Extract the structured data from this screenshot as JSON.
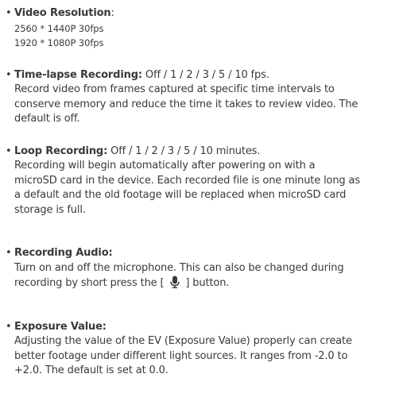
{
  "bullet": "•",
  "sections": [
    {
      "label": "Video Resolution",
      "label_suffix": ":",
      "sub_lines": [
        "2560 * 1440P 30fps",
        "1920 * 1080P 30fps"
      ]
    },
    {
      "label": "Time-lapse Recording:",
      "options": " Off / 1 / 2 / 3 / 5 / 10 fps.",
      "body_lines": [
        "Record video from frames captured at specific time intervals to",
        "conserve memory and reduce the time it takes to review video. The",
        "default is off."
      ]
    },
    {
      "label": "Loop Recording:",
      "options": " Off / 1 / 2 / 3 / 5 / 10 minutes.",
      "body_lines": [
        "Recording will begin automatically after powering on with a",
        "microSD card in the device. Each recorded file is one minute long as",
        "a default and the old footage will be replaced when microSD card",
        "storage is full."
      ]
    },
    {
      "label": "Recording Audio:",
      "body_lines": [
        "Turn on and off the microphone. This can also be changed during"
      ],
      "mic_line_before": "recording by short press the [",
      "mic_line_after": "] button.",
      "mic_icon_color": "#3a3a3a"
    },
    {
      "label": "Exposure Value:",
      "body_lines": [
        "Adjusting the value of the EV (Exposure Value) properly can create",
        "better footage under different light sources. It ranges from -2.0 to",
        "+2.0.  The default is set at 0.0."
      ]
    }
  ]
}
